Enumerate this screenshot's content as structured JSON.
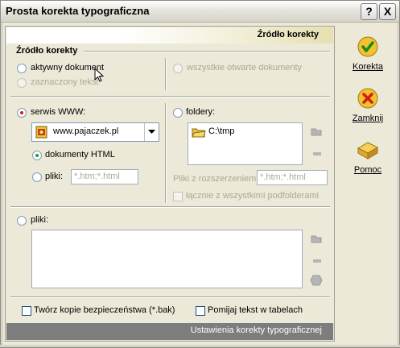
{
  "window": {
    "title": "Prosta korekta typograficzna",
    "help_btn": "?",
    "close_btn": "X"
  },
  "header": {
    "title": "Źródło korekty"
  },
  "source": {
    "group_label": "Źródło korekty",
    "active_doc": "aktywny dokument",
    "selected_text": "zaznaczony tekst",
    "all_open_docs": "wszystkie otwarte dokumenty"
  },
  "www": {
    "label": "serwis WWW:",
    "site": "www.pajaczek.pl",
    "html_docs": "dokumenty HTML",
    "files_label": "pliki:",
    "files_value": "*.htm;*.html"
  },
  "folders": {
    "label": "foldery:",
    "items": [
      "C:\\tmp"
    ],
    "ext_label": "Pliki z rozszerzeniem:",
    "ext_value": "*.htm;*.html",
    "subfolders": "łącznie z wszystkimi podfolderami"
  },
  "files": {
    "label": "pliki:"
  },
  "options": {
    "backup": "Twórz kopie bezpieczeństwa (*.bak)",
    "skip_tables": "Pomijaj tekst w tabelach"
  },
  "footer": {
    "text": "Ustawienia korekty typograficznej"
  },
  "right_buttons": {
    "korekta": "Korekta",
    "zamknij": "Zamknij",
    "pomoc": "Pomoc"
  },
  "colors": {
    "accent_green": "#21a121",
    "radio_red": "#cc2200",
    "footer_bg": "#7d7d7d"
  }
}
